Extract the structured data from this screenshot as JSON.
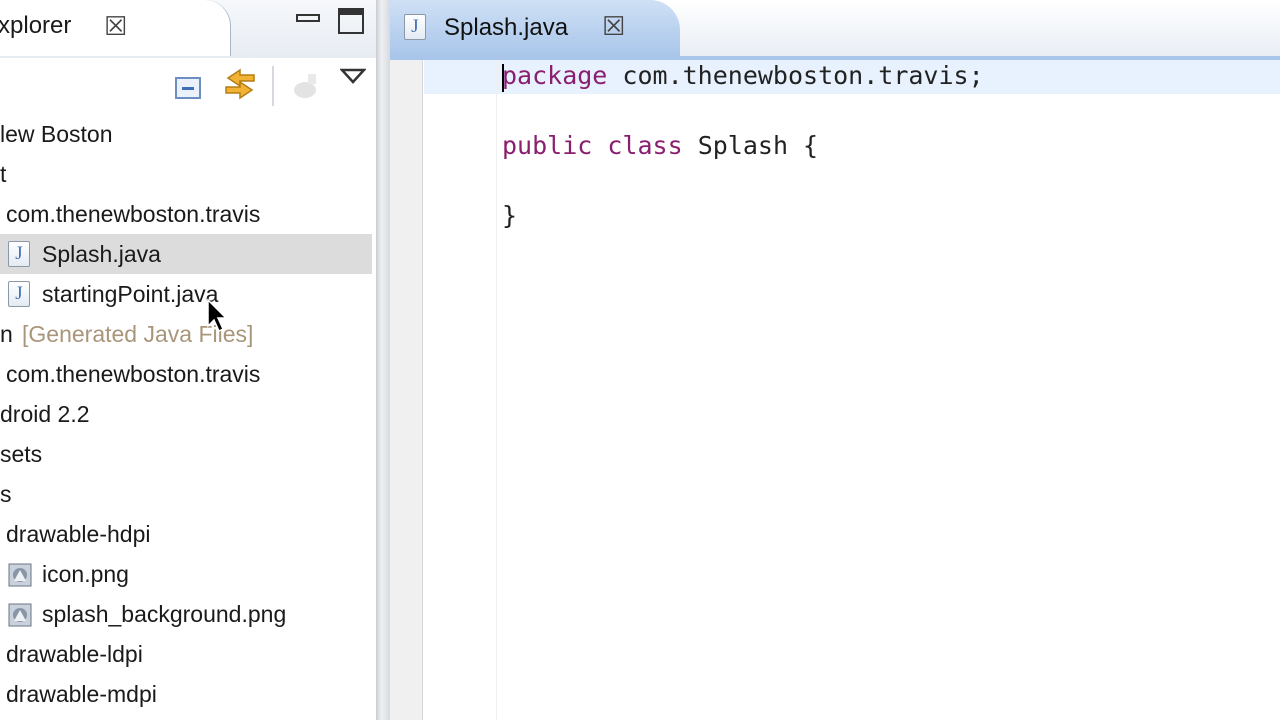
{
  "explorer": {
    "title": "Explorer",
    "close": "☒",
    "toolbar": {
      "collapse_icon": "collapse-all-icon",
      "link_icon": "link-with-editor-icon",
      "filter_icon": "filter-icon",
      "menu_icon": "view-menu-icon"
    },
    "tree": [
      {
        "text": "lew Boston"
      },
      {
        "text": "t"
      },
      {
        "text": "com.thenewboston.travis"
      },
      {
        "text": "Splash.java",
        "icon": "J",
        "selected": true
      },
      {
        "text": "startingPoint.java",
        "icon": "J"
      },
      {
        "text": "n",
        "muted": "[Generated Java Files]"
      },
      {
        "text": "com.thenewboston.travis"
      },
      {
        "text": "droid 2.2"
      },
      {
        "text": "sets"
      },
      {
        "text": "s"
      },
      {
        "text": "drawable-hdpi"
      },
      {
        "text": "icon.png"
      },
      {
        "text": "splash_background.png"
      },
      {
        "text": "drawable-ldpi"
      },
      {
        "text": "drawable-mdpi"
      }
    ]
  },
  "editor": {
    "tab": {
      "icon": "J",
      "label": "Splash.java",
      "close": "☒"
    },
    "code": {
      "line1_kw": "package",
      "line1_rest": " com.thenewboston.travis;",
      "line2_kw1": "public",
      "line2_kw2": "class",
      "line2_rest": " Splash {",
      "line3": "}"
    }
  },
  "colors": {
    "keyword": "#8a1f6f",
    "active_tab": "#a9c6ea",
    "selection": "#dcdcdc",
    "current_line": "#e8f2fe"
  }
}
